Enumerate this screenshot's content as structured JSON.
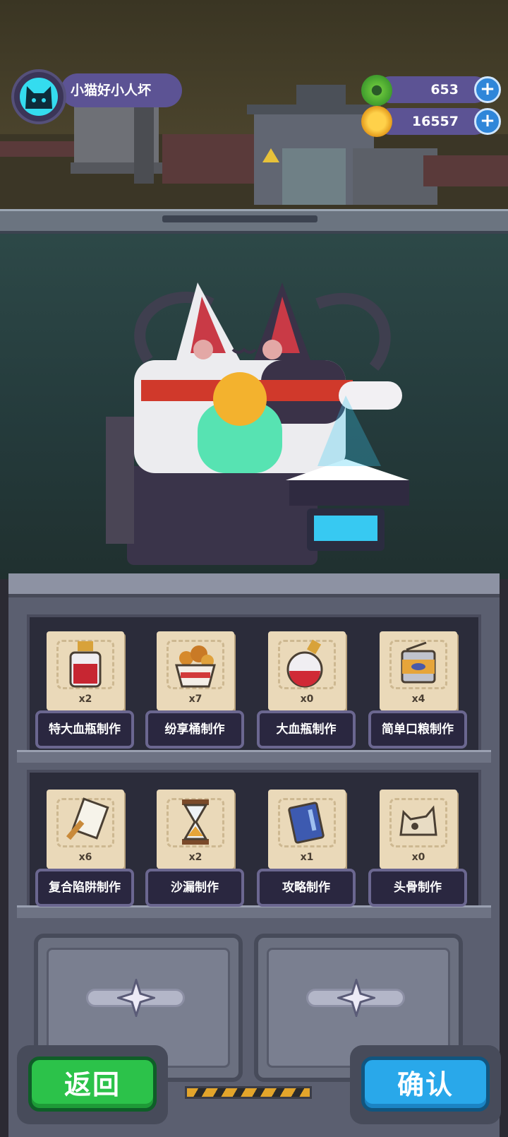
{
  "player": {
    "name": "小猫好小人坏"
  },
  "resources": [
    {
      "icon": "green-donut-icon",
      "value": "653"
    },
    {
      "icon": "gold-coin-icon",
      "value": "16557"
    }
  ],
  "crafting_items": [
    {
      "icon": "large-potion-bottle-icon",
      "quantity": "x2",
      "label": "特大血瓶制作"
    },
    {
      "icon": "bucket-meal-icon",
      "quantity": "x7",
      "label": "纷享桶制作"
    },
    {
      "icon": "potion-flask-icon",
      "quantity": "x0",
      "label": "大血瓶制作"
    },
    {
      "icon": "food-can-icon",
      "quantity": "x4",
      "label": "简单口粮制作"
    },
    {
      "icon": "trap-scroll-icon",
      "quantity": "x6",
      "label": "复合陷阱制作"
    },
    {
      "icon": "hourglass-icon",
      "quantity": "x2",
      "label": "沙漏制作"
    },
    {
      "icon": "guide-book-icon",
      "quantity": "x1",
      "label": "攻略制作"
    },
    {
      "icon": "skull-icon",
      "quantity": "x0",
      "label": "头骨制作"
    }
  ],
  "buttons": {
    "back": "返回",
    "confirm": "确认"
  },
  "colors": {
    "back_button": "#2cc24a",
    "confirm_button": "#29a8ea",
    "hud_pill": "#5c5394"
  }
}
